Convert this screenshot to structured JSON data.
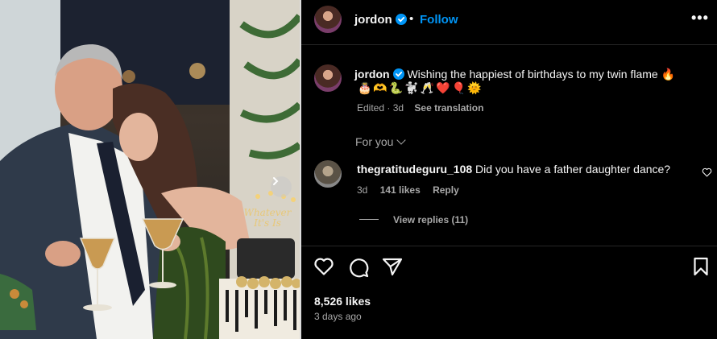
{
  "post": {
    "author": "jordon",
    "follow_label": "Follow",
    "more_label": "•••",
    "dot": "•",
    "caption_text": "Wishing the happiest of birthdays to my twin flame 🔥",
    "caption_emojis": "🎂🫶🐍🐩🥂❤️🎈🌞",
    "edited_label": "Edited · 3d",
    "see_translation_label": "See translation",
    "likes_count": "8,526 likes",
    "time_ago": "3 days ago"
  },
  "comments_section": {
    "sort_label": "For you",
    "comments": [
      {
        "username": "thegratitudeguru_108",
        "text": "Did you have a father daughter dance?",
        "age": "3d",
        "likes": "141 likes",
        "reply_label": "Reply",
        "view_replies_label": "View replies (11)"
      }
    ]
  },
  "photo": {
    "cake_topper_text": "Whatever It's Is"
  },
  "icons": {
    "verified": "verified-badge-icon",
    "like": "heart-icon",
    "comment": "comment-bubble-icon",
    "share": "paper-plane-icon",
    "save": "bookmark-icon",
    "next": "chevron-right-icon",
    "sort": "chevron-down-icon"
  },
  "colors": {
    "background": "#000000",
    "text": "#f5f5f5",
    "muted": "#a8a8a8",
    "accent": "#0095f6",
    "divider": "#262626"
  }
}
